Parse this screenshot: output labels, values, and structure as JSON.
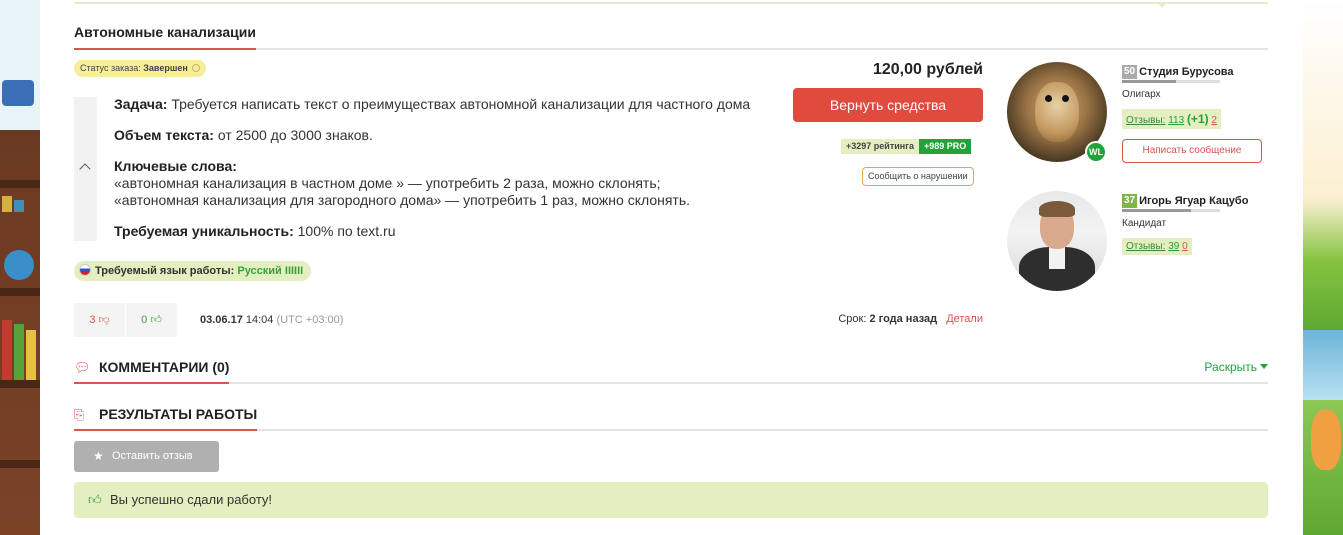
{
  "order": {
    "title": "Автономные канализации",
    "status_prefix": "Статус заказа:",
    "status_value": "Завершен",
    "task_label": "Задача:",
    "task_text": "Требуется написать текст о преимуществах автономной канализации для частного дома",
    "volume_label": "Объем текста:",
    "volume_text": "от 2500 до 3000 знаков.",
    "keywords_label": "Ключевые слова:",
    "keyword_1": "«автономная канализация в частном доме » — употребить 2 раза, можно склонять;",
    "keyword_2": "«автономная канализация для загородного дома» — употребить 1 раз, можно склонять.",
    "uniqueness_label": "Требуемая уникальность:",
    "uniqueness_text": "100% по text.ru",
    "language_label": "Требуемый язык работы:",
    "language_value": "Русский",
    "language_bars": "IIIIII"
  },
  "votes": {
    "down": "3",
    "up": "0"
  },
  "date": {
    "day": "03.06.17",
    "time": "14:04",
    "tz": "(UTC +03:00)"
  },
  "actions": {
    "price": "120,00 рублей",
    "refund_label": "Вернуть средства",
    "rating_label": "+3297 рейтинга",
    "pro_label": "+989 PRO",
    "report_label": "Сообщить о нарушении",
    "deadline_prefix": "Срок:",
    "deadline_value": "2 года назад",
    "details_label": "Детали"
  },
  "customer": {
    "level": "50",
    "name": "Студия Бурусова",
    "rank": "Олигарх",
    "reviews_label": "Отзывы:",
    "reviews_pos": "113",
    "reviews_plus": "(+1)",
    "reviews_neg": "2",
    "badge": "WL",
    "message_label": "Написать сообщение",
    "level_progress": 0.55
  },
  "executor": {
    "level": "37",
    "name": "Игорь Ягуар Кацубо",
    "rank": "Кандидат",
    "reviews_label": "Отзывы:",
    "reviews_pos": "39",
    "reviews_neg": "0",
    "level_progress": 0.7
  },
  "comments": {
    "title": "КОММЕНТАРИИ (0)",
    "expand_label": "Раскрыть"
  },
  "results": {
    "title": "РЕЗУЛЬТАТЫ РАБОТЫ",
    "review_button": "Оставить отзыв",
    "success_message": "Вы успешно сдали работу!"
  },
  "colors": {
    "accent_red": "#e04b3e",
    "accent_green": "#21a23a",
    "light_green": "#e3efc0"
  }
}
